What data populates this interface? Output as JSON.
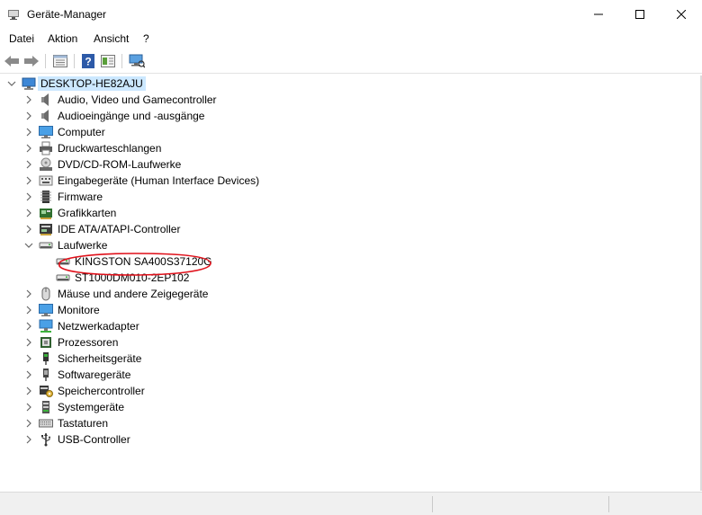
{
  "window": {
    "title": "Geräte-Manager",
    "icon": "device-manager-icon",
    "controls": [
      "minimize-icon",
      "maximize-icon",
      "close-icon"
    ]
  },
  "menu": [
    {
      "label": "Datei"
    },
    {
      "label": "Aktion"
    },
    {
      "label": "Ansicht"
    },
    {
      "label": "?"
    }
  ],
  "toolbar": {
    "buttons": [
      "back-arrow-icon",
      "forward-arrow-icon",
      "properties-icon",
      "help-icon",
      "show-hidden-icon",
      "scan-hardware-icon"
    ]
  },
  "tree": {
    "root": {
      "label": "DESKTOP-HE82AJU",
      "icon": "computer-icon",
      "expanded": true,
      "selected": true
    },
    "categories": [
      {
        "label": "Audio, Video und Gamecontroller",
        "icon": "speaker-icon"
      },
      {
        "label": "Audioeingänge und -ausgänge",
        "icon": "speaker-icon"
      },
      {
        "label": "Computer",
        "icon": "monitor-icon"
      },
      {
        "label": "Druckwarteschlangen",
        "icon": "printer-icon"
      },
      {
        "label": "DVD/CD-ROM-Laufwerke",
        "icon": "disc-drive-icon"
      },
      {
        "label": "Eingabegeräte (Human Interface Devices)",
        "icon": "hid-icon"
      },
      {
        "label": "Firmware",
        "icon": "chip-icon"
      },
      {
        "label": "Grafikkarten",
        "icon": "display-adapter-icon"
      },
      {
        "label": "IDE ATA/ATAPI-Controller",
        "icon": "controller-icon"
      },
      {
        "label": "Laufwerke",
        "icon": "disk-drive-icon",
        "expanded": true,
        "children": [
          {
            "label": "KINGSTON SA400S37120G",
            "icon": "disk-drive-icon",
            "highlighted": true
          },
          {
            "label": "ST1000DM010-2EP102",
            "icon": "disk-drive-icon"
          }
        ]
      },
      {
        "label": "Mäuse und andere Zeigegeräte",
        "icon": "mouse-icon"
      },
      {
        "label": "Monitore",
        "icon": "monitor-icon"
      },
      {
        "label": "Netzwerkadapter",
        "icon": "network-icon"
      },
      {
        "label": "Prozessoren",
        "icon": "processor-icon"
      },
      {
        "label": "Sicherheitsgeräte",
        "icon": "security-device-icon"
      },
      {
        "label": "Softwaregeräte",
        "icon": "software-device-icon"
      },
      {
        "label": "Speichercontroller",
        "icon": "storage-controller-icon"
      },
      {
        "label": "Systemgeräte",
        "icon": "system-device-icon"
      },
      {
        "label": "Tastaturen",
        "icon": "keyboard-icon"
      },
      {
        "label": "USB-Controller",
        "icon": "usb-icon"
      }
    ]
  },
  "colors": {
    "selection": "#cce8ff",
    "annotation": "#e0101a",
    "accent": "#1e73d6"
  }
}
